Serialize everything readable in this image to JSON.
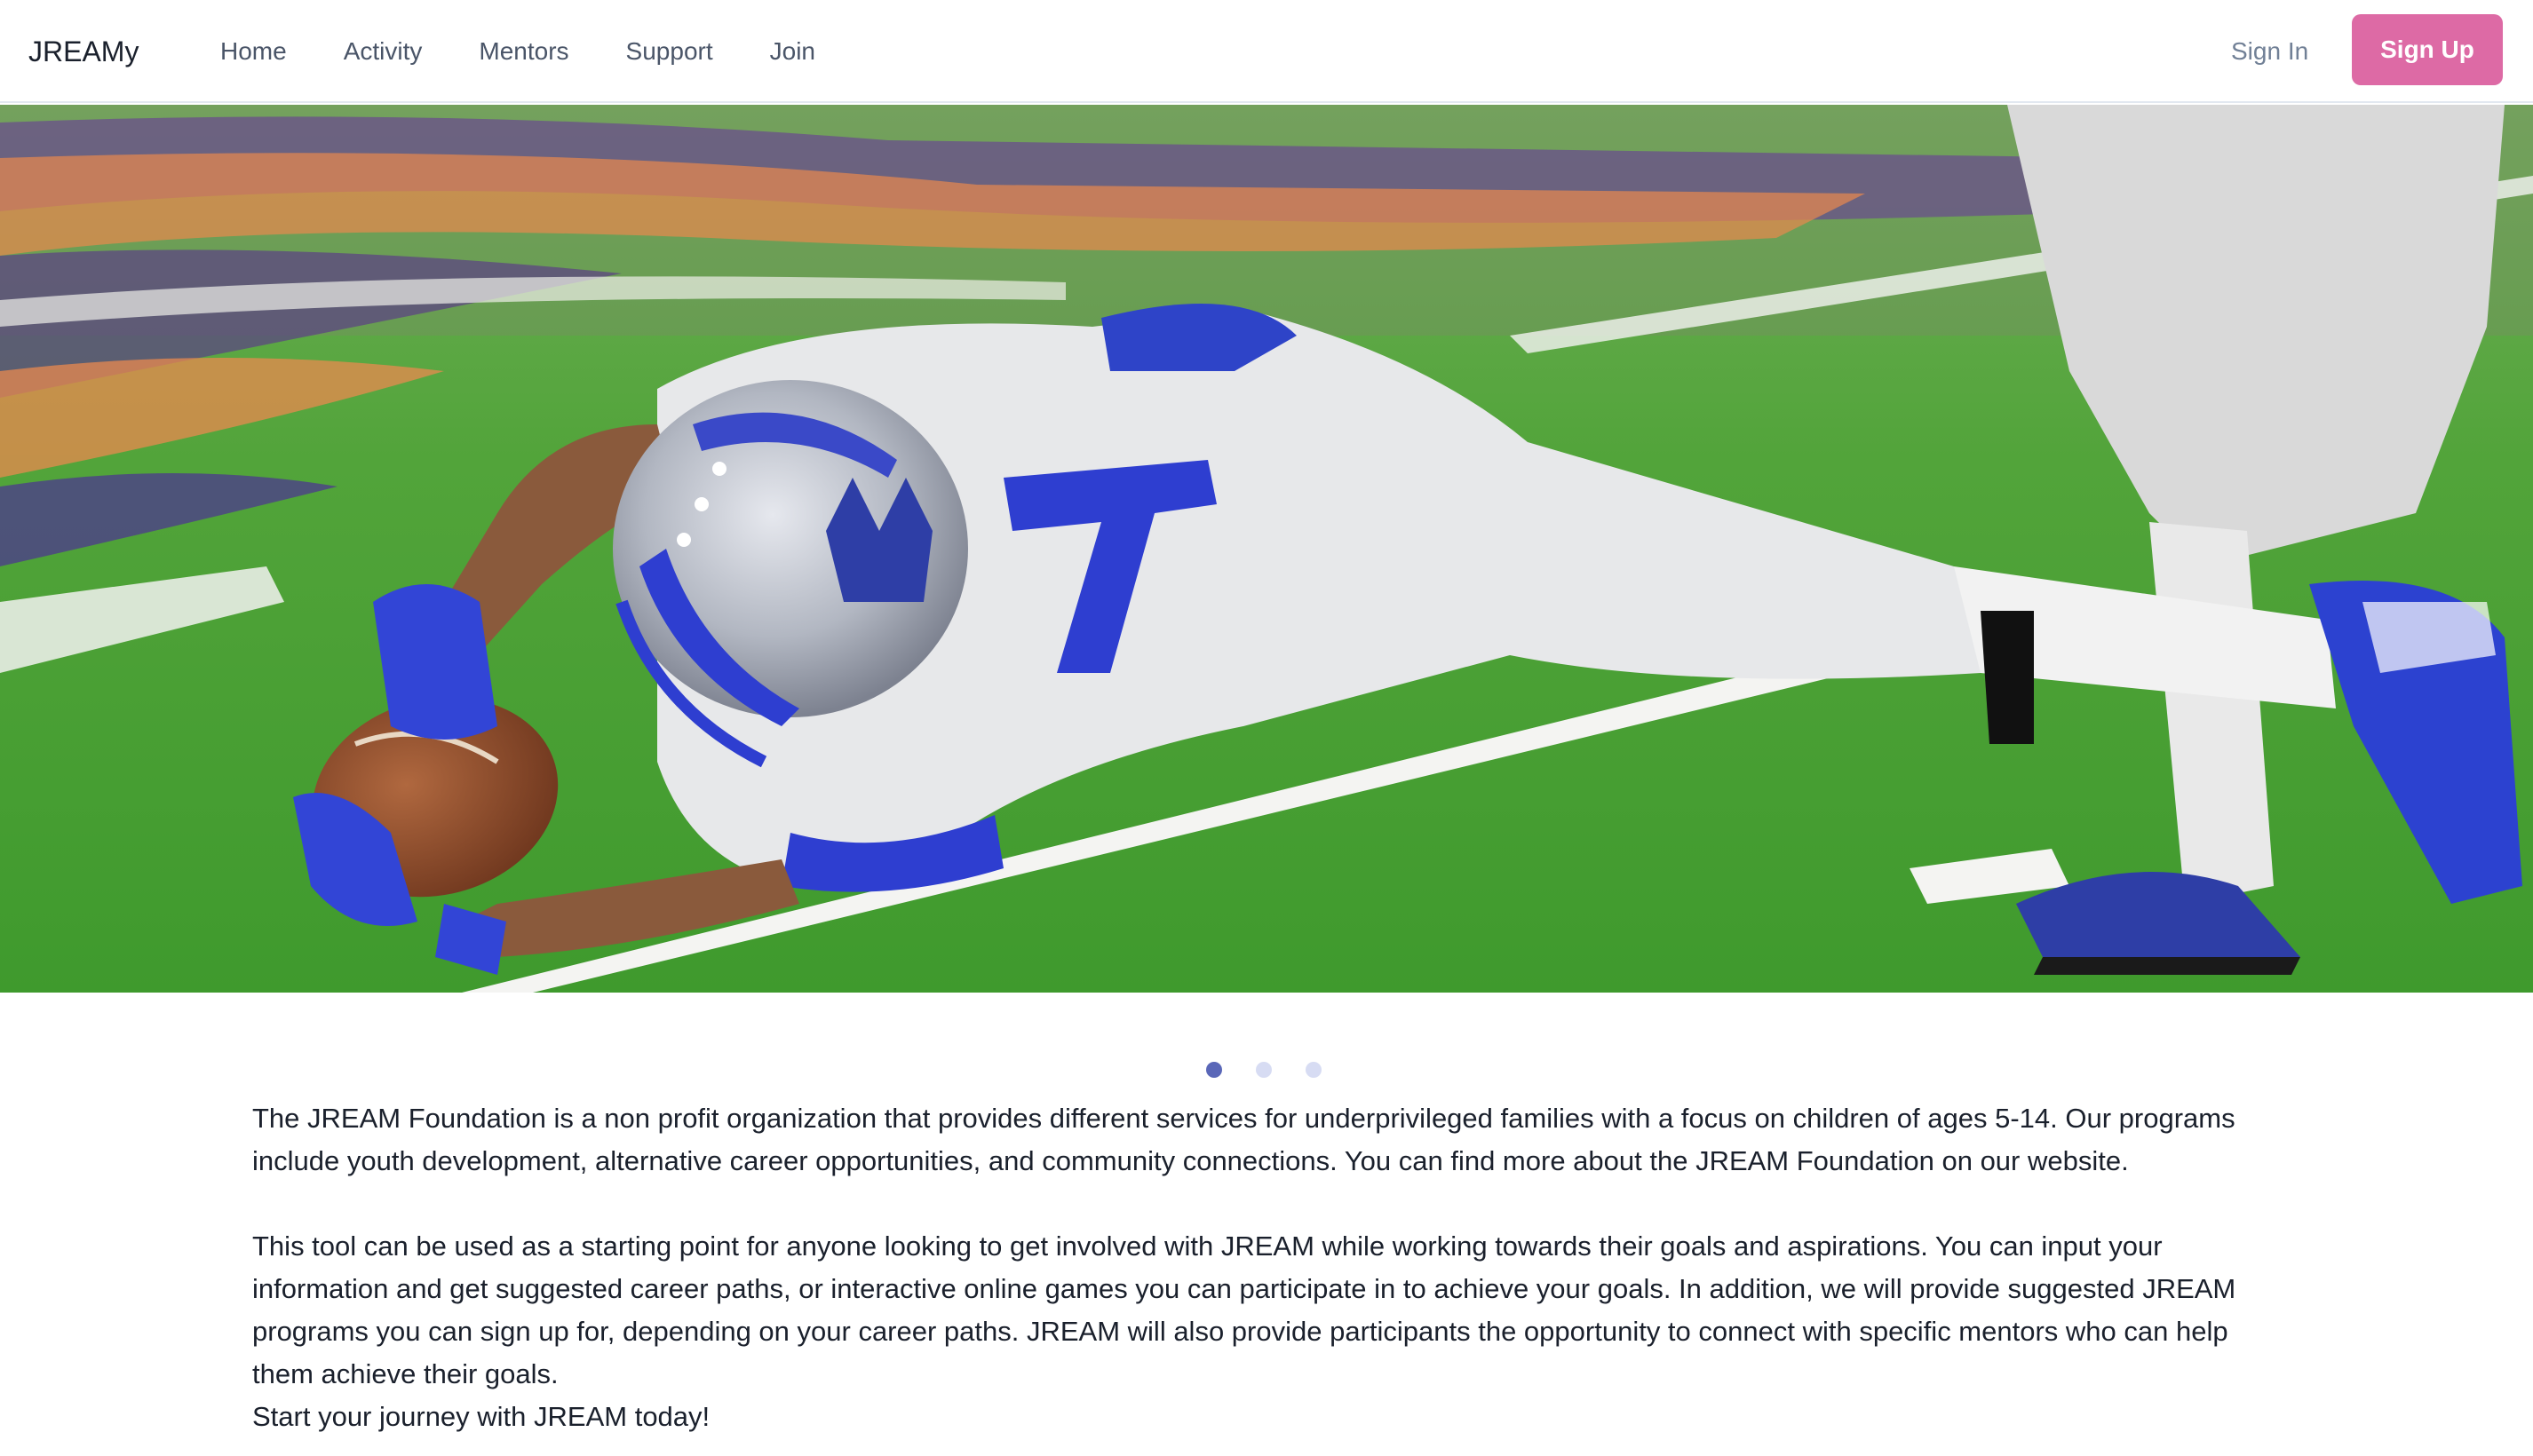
{
  "brand": "JREAMy",
  "nav": {
    "links": [
      "Home",
      "Activity",
      "Mentors",
      "Support",
      "Join"
    ],
    "sign_in": "Sign In",
    "sign_up": "Sign Up"
  },
  "carousel": {
    "image_alt": "football-player-diving-catch",
    "slide_count": 3,
    "active_slide": 1
  },
  "content": {
    "paragraph_1": "The JREAM Foundation is a non profit organization that provides different services for underprivileged families with a focus on children of ages 5-14. Our programs include youth development, alternative career opportunities, and community connections. You can find more about the JREAM Foundation on our website.",
    "paragraph_2": "This tool can be used as a starting point for anyone looking to get involved with JREAM while working towards their goals and aspirations. You can input your information and get suggested career paths, or interactive online games you can participate in to achieve your goals. In addition, we will provide suggested JREAM programs you can sign up for, depending on your career paths. JREAM will also provide participants the opportunity to connect with specific mentors who can help them achieve their goals.",
    "paragraph_3": "Start your journey with JREAM today!"
  },
  "colors": {
    "accent": "#dd6aa5",
    "dot_active": "#5a67b8",
    "dot_inactive": "#d7dcf3"
  }
}
